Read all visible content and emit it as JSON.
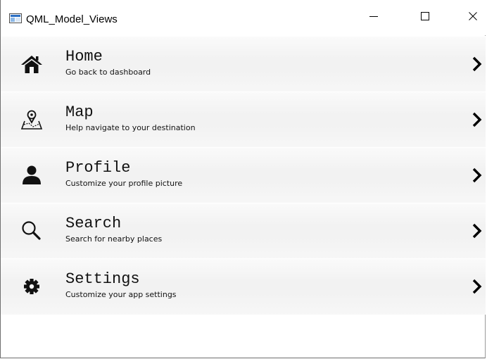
{
  "window": {
    "title": "QML_Model_Views",
    "controls": {
      "minimize": "minimize-icon",
      "maximize": "maximize-icon",
      "close": "close-icon"
    }
  },
  "menu": {
    "items": [
      {
        "label": "Home",
        "description": "Go back to dashboard",
        "icon": "home-icon"
      },
      {
        "label": "Map",
        "description": "Help navigate to your destination",
        "icon": "map-pin-icon"
      },
      {
        "label": "Profile",
        "description": "Customize your profile picture",
        "icon": "person-icon"
      },
      {
        "label": "Search",
        "description": "Search for nearby places",
        "icon": "search-icon"
      },
      {
        "label": "Settings",
        "description": "Customize your app settings",
        "icon": "gear-icon"
      }
    ],
    "chevron_icon": "chevron-right-icon"
  },
  "colors": {
    "row_background": "#f2f2f2",
    "text": "#111111"
  }
}
